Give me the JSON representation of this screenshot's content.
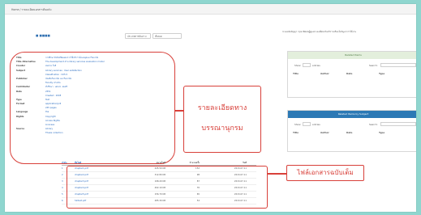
{
  "topbar": {
    "breadcrumb": "Home / รายละเอียดเอกสารต้นฉบับ"
  },
  "header": {
    "logo": "■ ■■■■",
    "select_a": "ประเภทการค้นหา ▾",
    "select_b": "ทั้งหมด",
    "help": "ระบบคลังปัญญา กรุณาติดต่อผู้ดูแลระบบเพื่อขอรับบริการหรือแจ้งปัญหาการใช้งาน"
  },
  "metadata": [
    {
      "key": "Title",
      "value": "การศึกษาปัจจัยที่มีผลต่อการใช้บริการห้องสมุดมหาวิทยาลัย"
    },
    {
      "key": "Title Alternative",
      "value": "The development of a library services evaluation model"
    },
    {
      "key": "Creator",
      "value": "สมชาย ใจดี"
    },
    {
      "key": "Subject",
      "value": "Library services ; User satisfaction"
    },
    {
      "key": "",
      "value": "Classification : 025.5"
    },
    {
      "key": "Publisher",
      "value": "บัณฑิตวิทยาลัย มหาวิทยาลัย"
    },
    {
      "key": "",
      "value": "Faculty of Arts"
    },
    {
      "key": "Contributor",
      "value": "ที่ปรึกษา : ผศ.ดร. สมศรี"
    },
    {
      "key": "Date",
      "value": "2551"
    },
    {
      "key": "",
      "value": "Created : 2008"
    },
    {
      "key": "Type",
      "value": "Text"
    },
    {
      "key": "Format",
      "value": "application/pdf"
    },
    {
      "key": "",
      "value": "245 pages"
    },
    {
      "key": "Language",
      "value": "tha"
    },
    {
      "key": "Rights",
      "value": "Copyright"
    },
    {
      "key": "",
      "value": "Access Rights"
    },
    {
      "key": "",
      "value": "Licenses"
    },
    {
      "key": "Source",
      "value": "Library"
    },
    {
      "key": "",
      "value": "Thesis collection"
    }
  ],
  "callouts": {
    "metadata_label_1": "รายละเอียดทาง",
    "metadata_label_2": "บรรณานุกรม",
    "files_label": "ไฟล์เอกสารฉบับเต็ม"
  },
  "panel_top": {
    "header": "Related Items",
    "show_label": "Show",
    "show_value": "10",
    "entries_label": "entries",
    "search_label": "Search:",
    "col_title": "Title",
    "col_author": "Author",
    "col_date": "Date",
    "col_type": "Type"
  },
  "panel_bottom": {
    "header": "Related Items by Subject",
    "show_label": "Show",
    "show_value": "10",
    "entries_label": "entries",
    "search_label": "Search:",
    "col_title": "Title",
    "col_author": "Author",
    "col_date": "Date",
    "col_type": "Type"
  },
  "files": {
    "headers": [
      "ลำดับ",
      "ชื่อไฟล์",
      "ขนาดไฟล์",
      "จำนวนครั้ง",
      "วันที่"
    ],
    "rows": [
      {
        "no": "1",
        "name": "chapter1.pdf",
        "size": "245.50 KB",
        "count": "152",
        "date": "2013-07-11"
      },
      {
        "no": "2",
        "name": "chapter2.pdf",
        "size": "312.80 KB",
        "count": "98",
        "date": "2013-07-11"
      },
      {
        "no": "3",
        "name": "chapter3.pdf",
        "size": "198.20 KB",
        "count": "87",
        "date": "2013-07-11"
      },
      {
        "no": "4",
        "name": "chapter4.pdf",
        "size": "402.10 KB",
        "count": "76",
        "date": "2013-07-11"
      },
      {
        "no": "5",
        "name": "chapter5.pdf",
        "size": "156.70 KB",
        "count": "65",
        "date": "2013-07-11"
      },
      {
        "no": "6",
        "name": "fulltext.pdf",
        "size": "285.30 KB",
        "count": "54",
        "date": "2013-07-11"
      }
    ]
  },
  "colors": {
    "accent": "#2c79b5",
    "annotation": "#d8403a",
    "background": "#8fd6cf"
  }
}
